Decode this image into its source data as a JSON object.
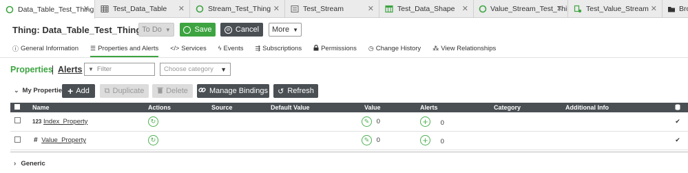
{
  "tabs": [
    {
      "label": "Data_Table_Test_Thing",
      "icon": "thing-icon",
      "active": true
    },
    {
      "label": "Test_Data_Table",
      "icon": "table-icon"
    },
    {
      "label": "Stream_Test_Thing",
      "icon": "thing-icon"
    },
    {
      "label": "Test_Stream",
      "icon": "stream-icon"
    },
    {
      "label": "Test_Data_Shape",
      "icon": "data-shape-icon"
    },
    {
      "label": "Value_Stream_Test_Thing",
      "icon": "thing-icon"
    },
    {
      "label": "Test_Value_Stream",
      "icon": "value-stream-icon"
    },
    {
      "label": "Brow",
      "icon": "folder-icon"
    }
  ],
  "header": {
    "title": "Thing: Data_Table_Test_Thing",
    "todo_label": "To Do",
    "save_label": "Save",
    "cancel_label": "Cancel",
    "more_label": "More"
  },
  "subnav": [
    {
      "label": "General Information",
      "icon": "info-icon"
    },
    {
      "label": "Properties and Alerts",
      "icon": "list-icon",
      "active": true
    },
    {
      "label": "Services",
      "icon": "code-icon"
    },
    {
      "label": "Events",
      "icon": "lightning-icon"
    },
    {
      "label": "Subscriptions",
      "icon": "subscriptions-icon"
    },
    {
      "label": "Permissions",
      "icon": "lock-icon"
    },
    {
      "label": "Change History",
      "icon": "clock-icon"
    },
    {
      "label": "View Relationships",
      "icon": "relationships-icon"
    }
  ],
  "section": {
    "properties_label": "Properties",
    "alerts_label": "Alerts",
    "filter_placeholder": "Filter",
    "category_placeholder": "Choose category"
  },
  "toolbar": {
    "group_label": "My Properties",
    "add_label": "Add",
    "duplicate_label": "Duplicate",
    "delete_label": "Delete",
    "manage_bindings_label": "Manage Bindings",
    "refresh_label": "Refresh"
  },
  "table": {
    "columns": [
      "Name",
      "Actions",
      "Source",
      "Default Value",
      "Value",
      "Alerts",
      "Category",
      "Additional Info"
    ],
    "rows": [
      {
        "type_badge": "123",
        "name": "Index_Property",
        "value": "0",
        "alerts": "0"
      },
      {
        "type_badge": "#",
        "name": "Value_Property",
        "value": "0",
        "alerts": "0"
      }
    ]
  },
  "footer": {
    "generic_label": "Generic"
  },
  "colors": {
    "accent_green": "#3da441",
    "dark_button": "#4a4f54",
    "table_header": "#4a4f54"
  }
}
